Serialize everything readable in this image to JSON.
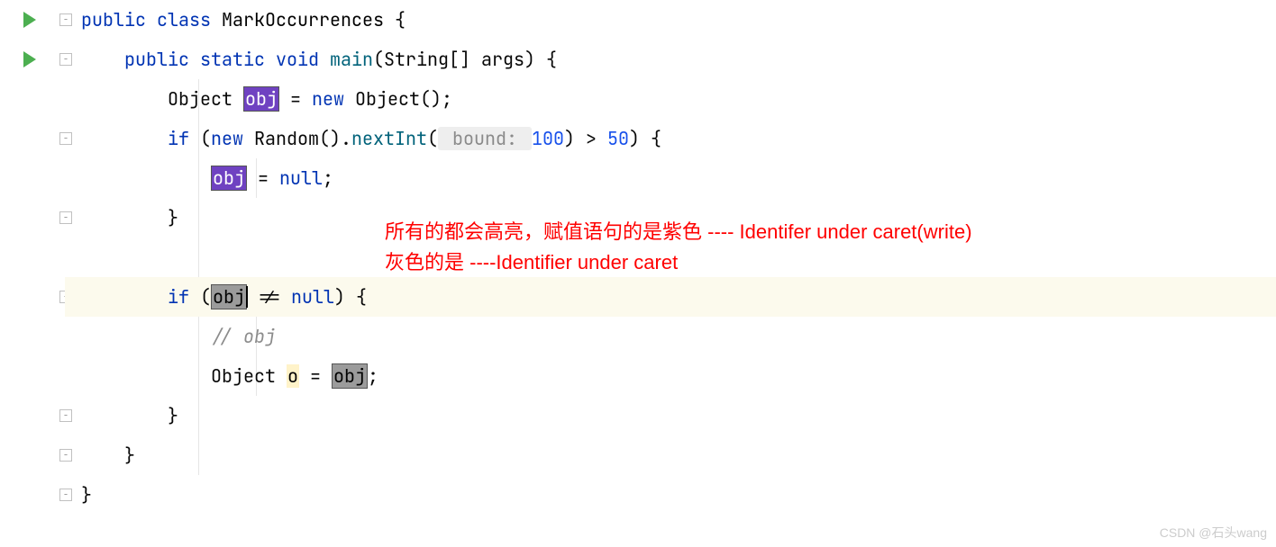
{
  "code": {
    "l1": {
      "kw1": "public",
      "kw2": "class",
      "cls": "MarkOccurrences",
      "brace": " {"
    },
    "l2": {
      "kw1": "public",
      "kw2": "static",
      "kw3": "void",
      "method": "main",
      "params": "(String[] args) {"
    },
    "l3": {
      "type": "Object ",
      "var": "obj",
      "eq": " = ",
      "kw": "new",
      "rest": " Object();"
    },
    "l4": {
      "kw1": "if",
      "open": " (",
      "kw2": "new",
      "cls": " Random().",
      "method": "nextInt",
      "p1": "(",
      "hint": " bound: ",
      "num": "100",
      "p2": ") > ",
      "num2": "50",
      "p3": ") {"
    },
    "l5": {
      "var": "obj",
      "eq": " = ",
      "nul": "null",
      "semi": ";"
    },
    "l6": {
      "brace": "}"
    },
    "l7": {
      "kw": "if",
      "open": " (",
      "var": "obj",
      "op": " != ",
      "nul": "null",
      "close": ") {"
    },
    "l8": {
      "comment": "// obj"
    },
    "l9": {
      "type": "Object ",
      "var": "o",
      "eq": " = ",
      "var2": "obj",
      "semi": ";"
    },
    "l10": {
      "brace": "}"
    },
    "l11": {
      "brace": "}"
    },
    "l12": {
      "brace": "}"
    }
  },
  "annotations": {
    "line1": "所有的都会高亮，赋值语句的是紫色 ---- Identifer under caret(write)",
    "line2": "灰色的是 ----Identifier under caret"
  },
  "watermark": "CSDN @石头wang"
}
